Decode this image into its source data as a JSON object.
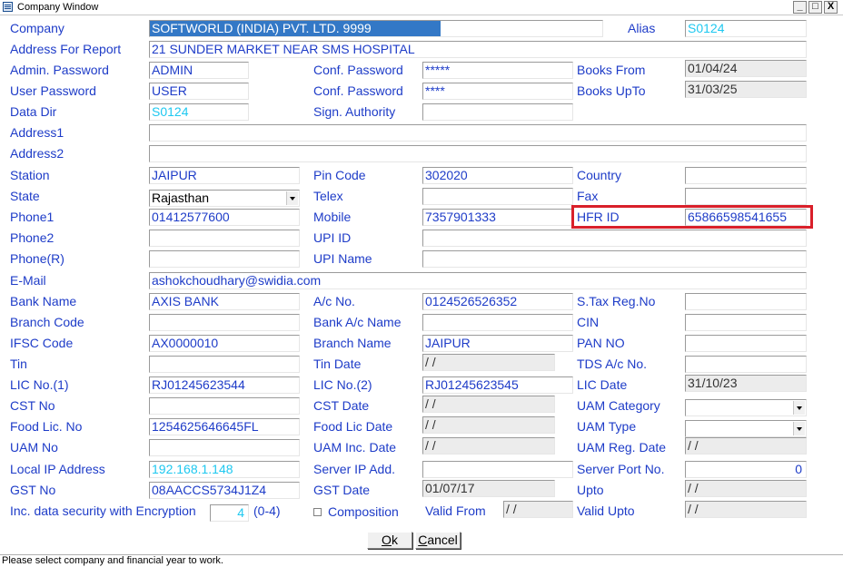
{
  "window": {
    "title": "Company Window",
    "min": "_",
    "max": "□",
    "close": "X"
  },
  "rows": {
    "company": {
      "label": "Company",
      "value": "SOFTWORLD (INDIA) PVT. LTD. 9999",
      "alias_label": "Alias",
      "alias_value": "S0124"
    },
    "address_report": {
      "label": "Address For Report",
      "value": "21 SUNDER MARKET NEAR SMS HOSPITAL"
    },
    "admin_password": {
      "label": "Admin.  Password",
      "value": "ADMIN",
      "conf_label": "Conf. Password",
      "conf_value": "*****",
      "books_from_label": "Books From",
      "books_from_value": "01/04/24"
    },
    "user_password": {
      "label": "User Password",
      "value": "USER",
      "conf_label": "Conf. Password",
      "conf_value": "****",
      "books_upto_label": "Books UpTo",
      "books_upto_value": "31/03/25"
    },
    "data_dir": {
      "label": "Data Dir",
      "value": "S0124",
      "sign_label": "Sign. Authority",
      "sign_value": ""
    },
    "address1": {
      "label": "Address1",
      "value": ""
    },
    "address2": {
      "label": "Address2",
      "value": ""
    },
    "station": {
      "label": "Station",
      "value": "JAIPUR",
      "pin_label": "Pin Code",
      "pin_value": "302020",
      "country_label": "Country",
      "country_value": ""
    },
    "state": {
      "label": "State",
      "value": "Rajasthan",
      "telex_label": "Telex",
      "telex_value": "",
      "fax_label": "Fax",
      "fax_value": ""
    },
    "phone1": {
      "label": "Phone1",
      "value": "01412577600",
      "mobile_label": "Mobile",
      "mobile_value": "7357901333",
      "hfr_label": "HFR ID",
      "hfr_value": "65866598541655"
    },
    "phone2": {
      "label": "Phone2",
      "value": "",
      "upi_id_label": "UPI ID",
      "upi_id_value": ""
    },
    "phone_r": {
      "label": "Phone(R)",
      "value": "",
      "upi_name_label": "UPI Name",
      "upi_name_value": ""
    },
    "email": {
      "label": "E-Mail",
      "value": "ashokchoudhary@swidia.com"
    },
    "bank": {
      "label": "Bank Name",
      "value": "AXIS BANK",
      "ac_label": "A/c No.",
      "ac_value": "0124526526352",
      "stax_label": "S.Tax Reg.No",
      "stax_value": ""
    },
    "branch_code": {
      "label": "Branch Code",
      "value": "",
      "bank_ac_name_label": "Bank A/c Name",
      "bank_ac_name_value": "",
      "cin_label": "CIN",
      "cin_value": ""
    },
    "ifsc": {
      "label": "IFSC Code",
      "value": "AX0000010",
      "branch_name_label": "Branch Name",
      "branch_name_value": "JAIPUR",
      "pan_label": "PAN NO",
      "pan_value": ""
    },
    "tin": {
      "label": "Tin",
      "value": "",
      "tin_date_label": "Tin Date",
      "tin_date_value": " / /",
      "tds_label": "TDS A/c No.",
      "tds_value": ""
    },
    "lic1": {
      "label": "LIC No.(1)",
      "value": "RJ01245623544",
      "lic2_label": "LIC No.(2)",
      "lic2_value": "RJ01245623545",
      "lic_date_label": "LIC Date",
      "lic_date_value": "31/10/23"
    },
    "cst": {
      "label": "CST No",
      "value": "",
      "cst_date_label": "CST Date",
      "cst_date_value": " / /",
      "uam_cat_label": "UAM Category",
      "uam_cat_value": ""
    },
    "food": {
      "label": "Food Lic. No",
      "value": "1254625646645FL",
      "food_date_label": "Food Lic Date",
      "food_date_value": " / /",
      "uam_type_label": "UAM Type",
      "uam_type_value": ""
    },
    "uam": {
      "label": "UAM No",
      "value": "",
      "uam_inc_label": "UAM Inc. Date",
      "uam_inc_value": " / /",
      "uam_reg_label": "UAM Reg. Date",
      "uam_reg_value": " / /"
    },
    "local_ip": {
      "label": "Local IP Address",
      "value": "192.168.1.148",
      "server_ip_label": "Server IP Add.",
      "server_ip_value": "",
      "server_port_label": "Server Port No.",
      "server_port_value": "0"
    },
    "gst": {
      "label": "GST No",
      "value": "08AACCS5734J1Z4",
      "gst_date_label": "GST Date",
      "gst_date_value": "01/07/17",
      "upto_label": "Upto",
      "upto_value": " / /"
    },
    "encryption": {
      "label": "Inc. data security with Encryption",
      "value": "4",
      "range": "(0-4)",
      "composition_label": "Composition",
      "valid_from_label": "Valid From",
      "valid_from_value": " / /",
      "valid_upto_label": "Valid Upto",
      "valid_upto_value": " / /"
    }
  },
  "buttons": {
    "ok_key": "O",
    "ok_rest": "k",
    "cancel_key": "C",
    "cancel_rest": "ancel"
  },
  "status": "Please select company and financial year to work."
}
